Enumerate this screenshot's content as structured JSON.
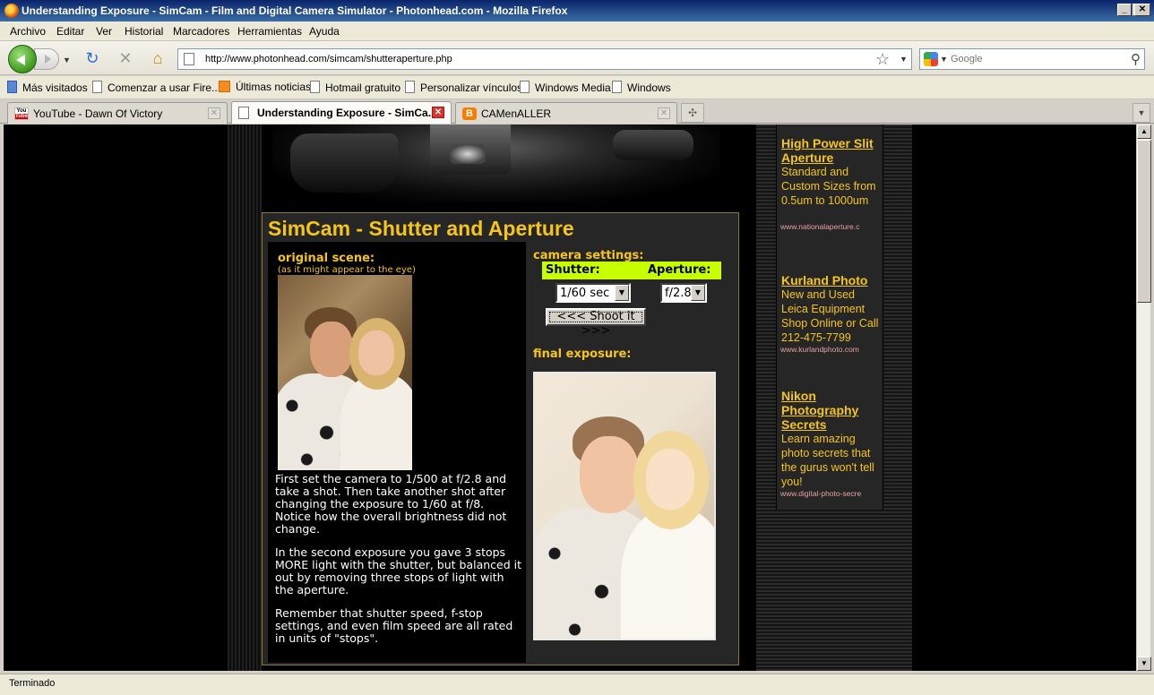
{
  "window": {
    "title": "Understanding Exposure - SimCam - Film and Digital Camera Simulator - Photonhead.com - Mozilla Firefox",
    "buttons": {
      "minimize": "_",
      "maximize": "□",
      "close": "✕"
    }
  },
  "menu": [
    "Archivo",
    "Editar",
    "Ver",
    "Historial",
    "Marcadores",
    "Herramientas",
    "Ayuda"
  ],
  "navigation": {
    "url": "http://www.photonhead.com/simcam/shutteraperture.php",
    "search_placeholder": "Google"
  },
  "bookmarks": [
    {
      "label": "Más visitados",
      "icon": "star-folder-icon"
    },
    {
      "label": "Comenzar a usar Fire...",
      "icon": "page-icon"
    },
    {
      "label": "Últimas noticias",
      "icon": "rss-icon"
    },
    {
      "label": "Hotmail gratuito",
      "icon": "page-icon"
    },
    {
      "label": "Personalizar vínculos",
      "icon": "page-icon"
    },
    {
      "label": "Windows Media",
      "icon": "page-icon"
    },
    {
      "label": "Windows",
      "icon": "page-icon"
    }
  ],
  "tabs": [
    {
      "label": "YouTube - Dawn Of Victory",
      "icon": "youtube-icon",
      "active": false
    },
    {
      "label": "Understanding Exposure - SimCa...",
      "icon": "page-icon",
      "active": true
    },
    {
      "label": "CAMenALLER",
      "icon": "blogger-icon",
      "active": false
    }
  ],
  "youtube_icon": {
    "top": "You",
    "bottom": "Tube"
  },
  "blogger_icon": "B",
  "page": {
    "title": "SimCam - Shutter and Aperture",
    "original_scene": {
      "label": "original scene:",
      "sub": "(as it might appear to the eye)"
    },
    "paragraphs": [
      "First set the camera to 1/500 at f/2.8 and take a shot. Then take another shot after changing the exposure to 1/60 at f/8. Notice how the overall brightness did not change.",
      "In the second exposure you gave 3 stops MORE light with the shutter, but balanced it out by removing three stops of light with the aperture.",
      "Remember that shutter speed, f-stop settings, and even film speed are all rated in units of \"stops\"."
    ],
    "camera_settings": {
      "label": "camera settings:",
      "shutter_label": "Shutter:",
      "aperture_label": "Aperture:",
      "shutter_value": "1/60 sec",
      "aperture_value": "f/2.8",
      "shoot_button": "<<< Shoot it >>>"
    },
    "final_exposure_label": "final exposure:"
  },
  "ads": [
    {
      "title": "High Power Slit Aperture",
      "text": "Standard and Custom Sizes from 0.5um to 1000um",
      "url": "www.nationalaperture.c"
    },
    {
      "title": "Kurland Photo",
      "text": "New and Used Leica Equipment Shop Online or Call 212-475-7799",
      "url": "www.kurlandphoto.com"
    },
    {
      "title": "Nikon Photography Secrets",
      "text": "Learn amazing photo secrets that the gurus won't tell you!",
      "url": "www.digital-photo-secre"
    }
  ],
  "status": "Terminado"
}
